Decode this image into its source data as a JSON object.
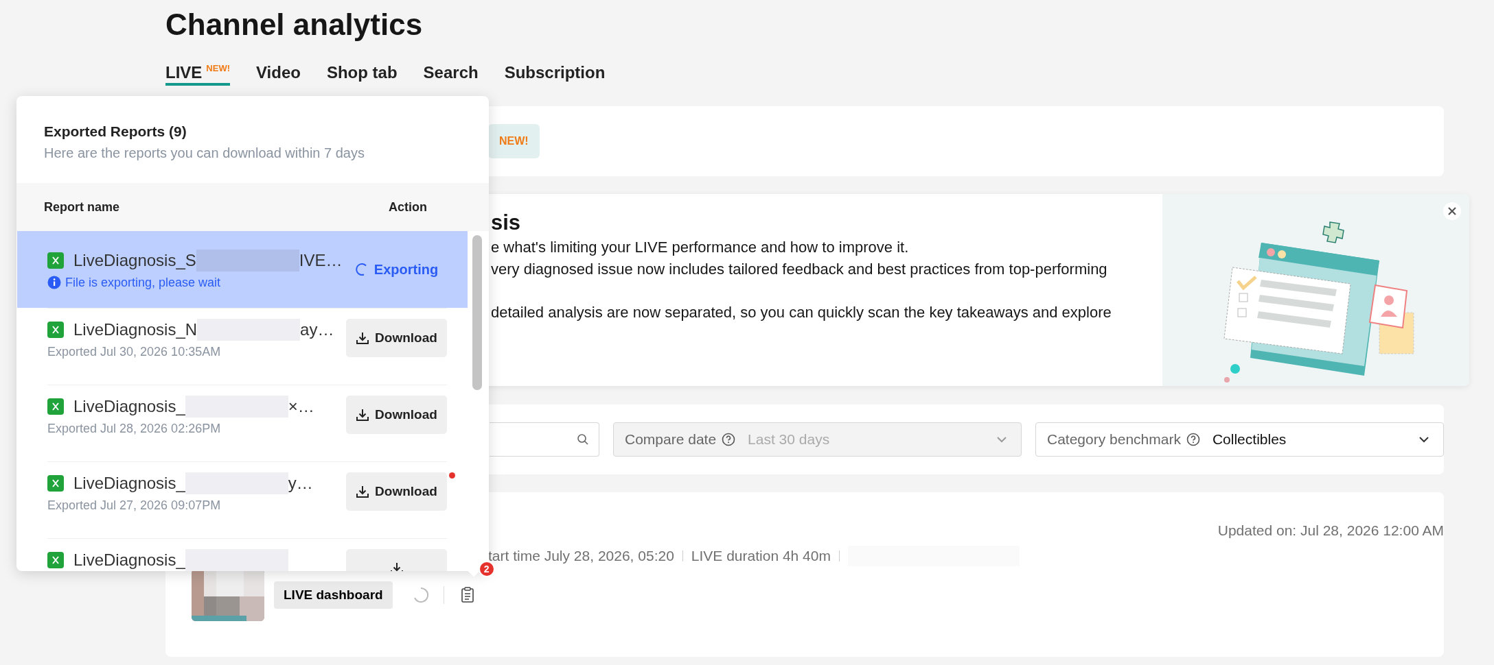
{
  "page_title": "Channel analytics",
  "tabs": [
    {
      "label": "LIVE",
      "badge": "NEW!",
      "selected": true
    },
    {
      "label": "Video",
      "selected": false
    },
    {
      "label": "Shop tab",
      "selected": false
    },
    {
      "label": "Search",
      "selected": false
    },
    {
      "label": "Subscription",
      "selected": false
    }
  ],
  "announcement": {
    "badge": "NEW!"
  },
  "banner": {
    "title": "sis",
    "lines": [
      "e what's limiting your LIVE performance and how to improve it.",
      "very diagnosed issue now includes tailored feedback and best practices from top-performing",
      " detailed analysis are now separated, so you can quickly scan the key takeaways and explore"
    ]
  },
  "filters": [
    {
      "label": "Compare date",
      "value": "Last 30 days",
      "disabled": true
    },
    {
      "label": "Category benchmark",
      "value": "Collectibles",
      "disabled": false
    }
  ],
  "session": {
    "updated": "Updated on: Jul 28, 2026 12:00 AM",
    "meta": [
      "tart time July 28, 2026, 05:20",
      "LIVE duration 4h 40m"
    ],
    "dashboard_button": "LIVE dashboard",
    "notification_count": "2"
  },
  "export_panel": {
    "title": "Exported Reports (9)",
    "subtitle": "Here are the reports you can download within 7 days",
    "columns": [
      "Report name",
      "Action"
    ],
    "reports": [
      {
        "kind": "exporting",
        "name_start": "LiveDiagnosis_S",
        "name_end": "IVE…",
        "note": "File is exporting, please wait",
        "action": "Exporting",
        "selected": true,
        "unread": false
      },
      {
        "kind": "done",
        "name_start": "LiveDiagnosis_N",
        "name_end": "ay…",
        "note": "Exported Jul 30, 2026 10:35AM",
        "action": "Download",
        "selected": false,
        "unread": false
      },
      {
        "kind": "done",
        "name_start": "LiveDiagnosis_",
        "name_end": "×…",
        "note": "Exported Jul 28, 2026 02:26PM",
        "action": "Download",
        "selected": false,
        "unread": false
      },
      {
        "kind": "done",
        "name_start": "LiveDiagnosis_",
        "name_end": "y…",
        "note": "Exported Jul 27, 2026 09:07PM",
        "action": "Download",
        "selected": false,
        "unread": true
      },
      {
        "kind": "done",
        "name_start": "LiveDiagnosis_",
        "selected": false,
        "unread": false
      }
    ]
  }
}
